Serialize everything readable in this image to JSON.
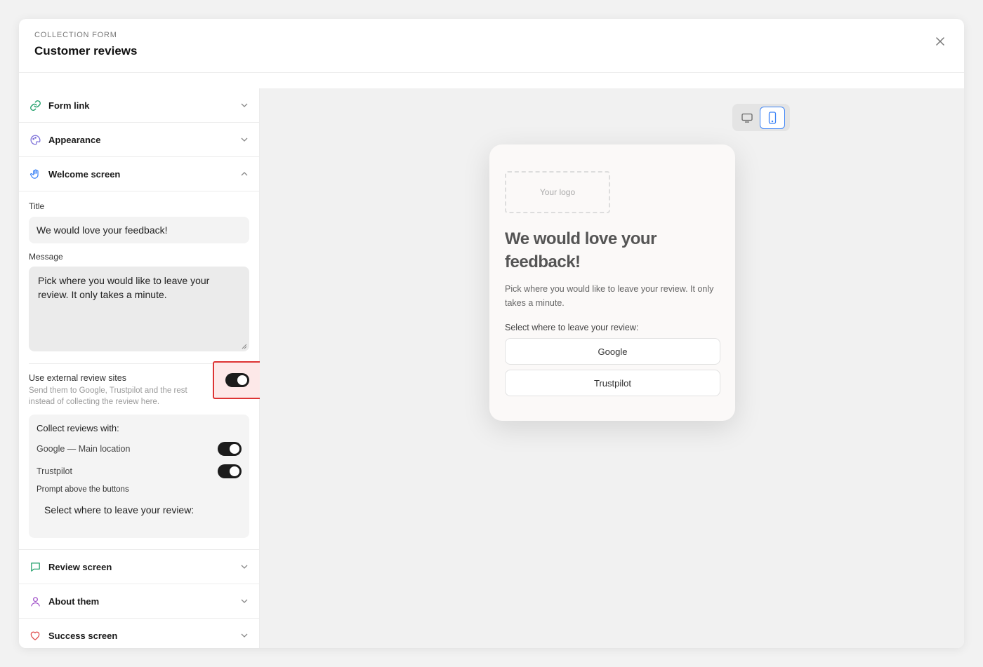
{
  "header": {
    "kicker": "COLLECTION FORM",
    "title": "Customer reviews",
    "close_icon": "close-icon"
  },
  "sidebar": {
    "sections": [
      {
        "label": "Form link",
        "icon": "link-icon",
        "color": "#22a06b",
        "expanded": false
      },
      {
        "label": "Appearance",
        "icon": "palette-icon",
        "color": "#7c6fd8",
        "expanded": false
      },
      {
        "label": "Welcome screen",
        "icon": "hand-wave-icon",
        "color": "#3b82f6",
        "expanded": true
      },
      {
        "label": "Review screen",
        "icon": "chat-icon",
        "color": "#22a06b",
        "expanded": false
      },
      {
        "label": "About them",
        "icon": "person-icon",
        "color": "#a050c8",
        "expanded": false
      },
      {
        "label": "Success screen",
        "icon": "heart-icon",
        "color": "#e05050",
        "expanded": false
      }
    ],
    "welcome": {
      "title_label": "Title",
      "title_value": "We would love your feedback!",
      "message_label": "Message",
      "message_value": "Pick where you would like to leave your review. It only takes a minute.",
      "external_title": "Use external review sites",
      "external_desc": "Send them to Google, Trustpilot and the rest instead of collecting the review here.",
      "external_enabled": true,
      "collect": {
        "title": "Collect reviews with:",
        "items": [
          {
            "name": "Google — Main location",
            "enabled": true
          },
          {
            "name": "Trustpilot",
            "enabled": true
          }
        ],
        "prompt_label": "Prompt above the buttons",
        "prompt_value": "Select where to leave your review:"
      }
    }
  },
  "preview": {
    "device_options": [
      "desktop-icon",
      "mobile-icon"
    ],
    "active_device": "mobile",
    "logo_placeholder": "Your logo",
    "title": "We would love your feedback!",
    "message": "Pick where you would like to leave your review. It only takes a minute.",
    "prompt": "Select where to leave your review:",
    "buttons": [
      "Google",
      "Trustpilot"
    ]
  },
  "colors": {
    "highlight_border": "#d33333",
    "active_device_border": "#3b82f6",
    "toggle_on": "#1c1c1c"
  }
}
